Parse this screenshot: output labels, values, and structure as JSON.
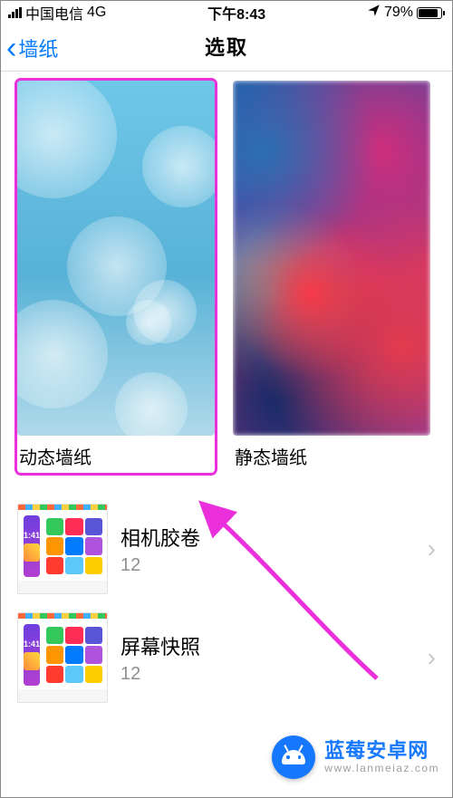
{
  "status": {
    "carrier": "中国电信",
    "network": "4G",
    "time": "下午8:43",
    "battery_pct": "79%"
  },
  "nav": {
    "back_label": "墙纸",
    "title": "选取"
  },
  "categories": [
    {
      "key": "dynamic",
      "label": "动态墙纸"
    },
    {
      "key": "static",
      "label": "静态墙纸"
    }
  ],
  "albums": [
    {
      "key": "camera_roll",
      "title": "相机胶卷",
      "count": "12"
    },
    {
      "key": "screenshots",
      "title": "屏幕快照",
      "count": "12"
    }
  ],
  "annotation": {
    "arrow_color": "#ea2fdb"
  },
  "watermark": {
    "brand": "蓝莓安卓网",
    "url": "www.lanmeiaz.com"
  }
}
